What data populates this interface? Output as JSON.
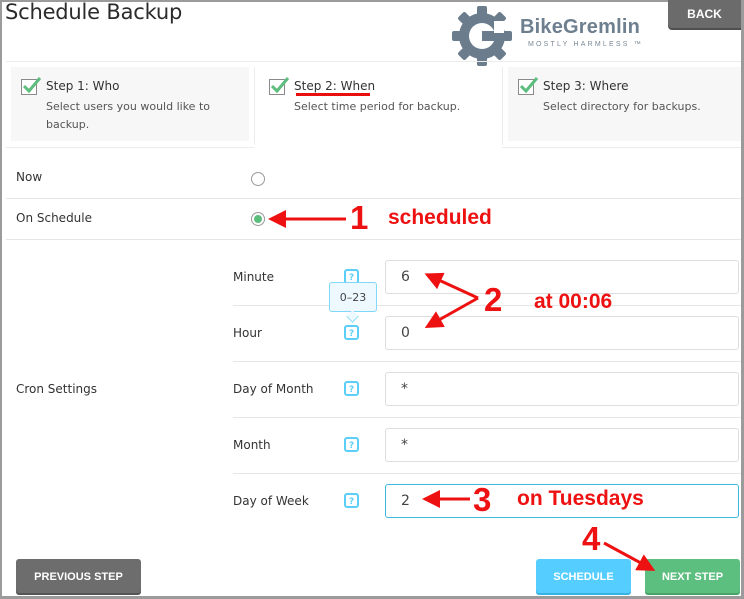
{
  "page": {
    "title": "Schedule Backup",
    "back_label": "BACK"
  },
  "logo": {
    "name": "BikeGremlin",
    "tagline": "MOSTLY HARMLESS ™"
  },
  "steps": [
    {
      "title": "Step 1: Who",
      "description": "Select users you would like to backup.",
      "desc_line1": "Select users you would like to",
      "desc_line2": "backup.",
      "checked": true,
      "active": false
    },
    {
      "title": "Step 2: When",
      "description": "Select time period for backup.",
      "checked": true,
      "active": true
    },
    {
      "title": "Step 3: Where",
      "description": "Select directory for backups.",
      "checked": true,
      "active": false
    }
  ],
  "timing": {
    "options": [
      {
        "label": "Now",
        "selected": false
      },
      {
        "label": "On Schedule",
        "selected": true
      }
    ]
  },
  "cron": {
    "section_label": "Cron Settings",
    "help_glyph": "?",
    "tooltip": "0–23",
    "fields": [
      {
        "label": "Minute",
        "value": "6"
      },
      {
        "label": "Hour",
        "value": "0"
      },
      {
        "label": "Day of Month",
        "value": "*"
      },
      {
        "label": "Month",
        "value": "*"
      },
      {
        "label": "Day of Week",
        "value": "2"
      }
    ]
  },
  "footer": {
    "previous_label": "PREVIOUS STEP",
    "schedule_label": "SCHEDULE",
    "next_label": "NEXT STEP"
  },
  "annotations": {
    "n1": "1",
    "t1": "scheduled",
    "n2": "2",
    "t2": "at 00:06",
    "n3": "3",
    "t3": "on Tuesdays",
    "n4": "4",
    "color": "#ee1111"
  },
  "colors": {
    "check_green": "#5cbd7d",
    "help_blue": "#5bcff7",
    "schedule_blue": "#55ceff",
    "next_green": "#5cbe7f",
    "prev_gray": "#6d6d6d"
  }
}
